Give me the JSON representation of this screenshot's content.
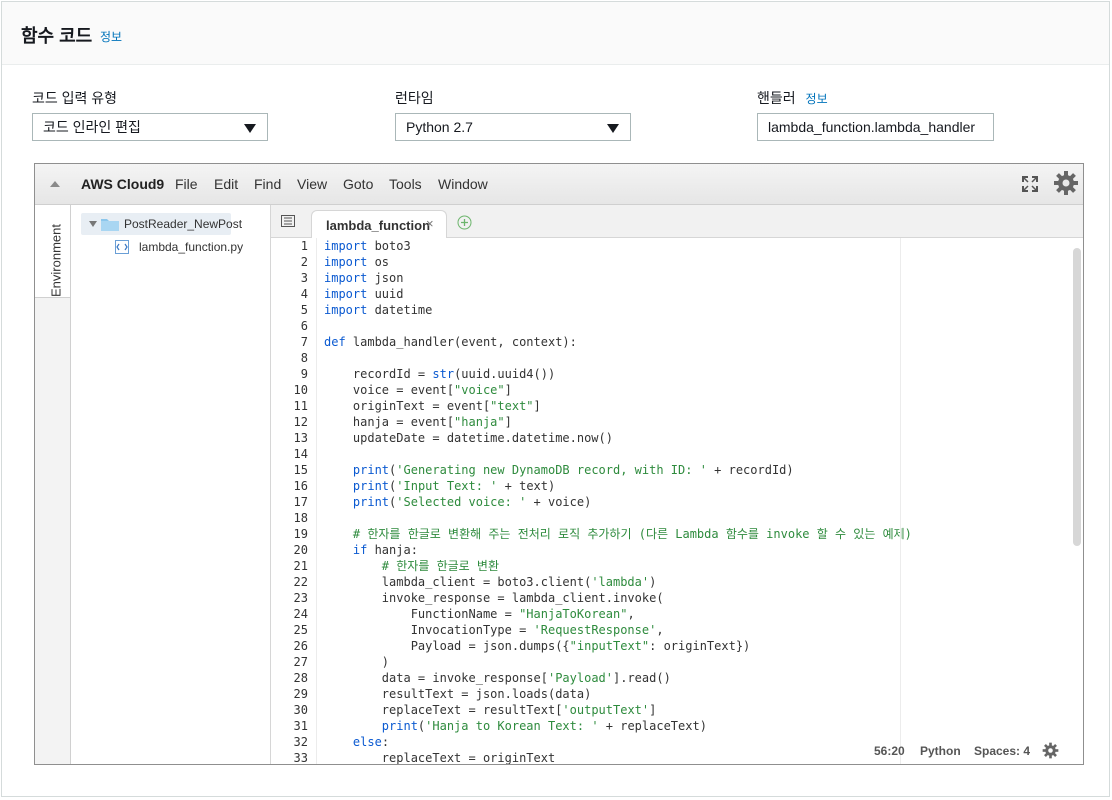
{
  "panel": {
    "title": "함수 코드",
    "info": "정보"
  },
  "fields": {
    "code_entry": {
      "label": "코드 입력 유형",
      "value": "코드 인라인 편집"
    },
    "runtime": {
      "label": "런타임",
      "value": "Python 2.7"
    },
    "handler": {
      "label": "핸들러",
      "info": "정보",
      "value": "lambda_function.lambda_handler"
    }
  },
  "ide": {
    "brand": "AWS Cloud9",
    "menu": [
      "File",
      "Edit",
      "Find",
      "View",
      "Goto",
      "Tools",
      "Window"
    ],
    "side_tab": "Environment",
    "tree": {
      "root": "PostReader_NewPost",
      "file": "lambda_function.py"
    },
    "tab": {
      "label": "lambda_function",
      "close": "×"
    },
    "code_lines": [
      "import boto3",
      "import os",
      "import json",
      "import uuid",
      "import datetime",
      "",
      "def lambda_handler(event, context):",
      "",
      "    recordId = str(uuid.uuid4())",
      "    voice = event[\"voice\"]",
      "    originText = event[\"text\"]",
      "    hanja = event[\"hanja\"]",
      "    updateDate = datetime.datetime.now()",
      "",
      "    print('Generating new DynamoDB record, with ID: ' + recordId)",
      "    print('Input Text: ' + text)",
      "    print('Selected voice: ' + voice)",
      "",
      "    # 한자를 한글로 변환해 주는 전처리 로직 추가하기 (다른 Lambda 함수를 invoke 할 수 있는 예제)",
      "    if hanja:",
      "        # 한자를 한글로 변환",
      "        lambda_client = boto3.client('lambda')",
      "        invoke_response = lambda_client.invoke(",
      "            FunctionName = \"HanjaToKorean\",",
      "            InvocationType = 'RequestResponse',",
      "            Payload = json.dumps({\"inputText\": originText})",
      "        )",
      "        data = invoke_response['Payload'].read()",
      "        resultText = json.loads(data)",
      "        replaceText = resultText['outputText']",
      "        print('Hanja to Korean Text: ' + replaceText)",
      "    else:",
      "        replaceText = originText"
    ],
    "status": {
      "cursor": "56:20",
      "language": "Python",
      "spaces": "Spaces: 4"
    },
    "icons": [
      "collapse-icon",
      "fullscreen-icon",
      "gear-icon",
      "folder-icon",
      "python-file-icon",
      "tab-list-icon",
      "add-tab-icon"
    ]
  }
}
